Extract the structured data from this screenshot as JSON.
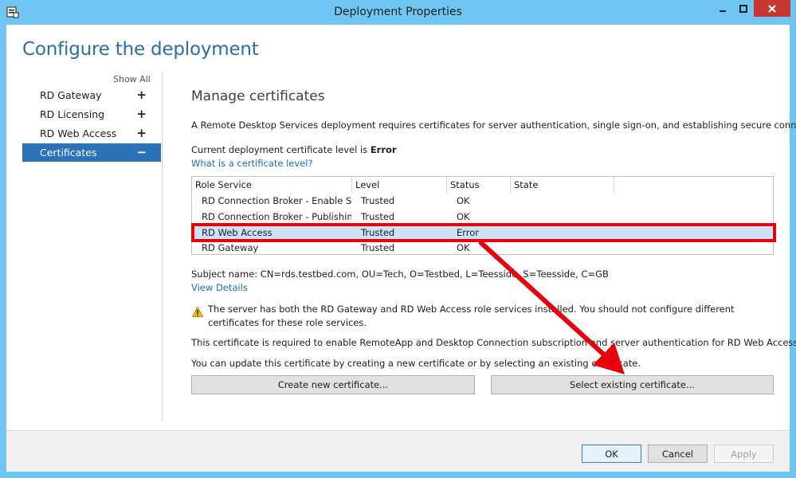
{
  "window": {
    "title": "Deployment Properties"
  },
  "page": {
    "heading": "Configure the deployment",
    "show_all": "Show All"
  },
  "sidebar": {
    "items": [
      {
        "label": "RD Gateway",
        "toggle": "+"
      },
      {
        "label": "RD Licensing",
        "toggle": "+"
      },
      {
        "label": "RD Web Access",
        "toggle": "+"
      },
      {
        "label": "Certificates",
        "toggle": "−"
      }
    ]
  },
  "main": {
    "title": "Manage certificates",
    "intro": "A Remote Desktop Services deployment requires certificates for server authentication, single sign-on, and establishing secure connections.",
    "level_prefix": "Current deployment certificate level is ",
    "level_value": "Error",
    "level_link": "What is a certificate level?",
    "table": {
      "headers": [
        "Role Service",
        "Level",
        "Status",
        "State"
      ],
      "rows": [
        {
          "role": "RD Connection Broker - Enable Single Sign On",
          "level": "Trusted",
          "status": "OK",
          "state": ""
        },
        {
          "role": "RD Connection Broker - Publishing",
          "level": "Trusted",
          "status": "OK",
          "state": ""
        },
        {
          "role": "RD Web Access",
          "level": "Trusted",
          "status": "Error",
          "state": ""
        },
        {
          "role": "RD Gateway",
          "level": "Trusted",
          "status": "OK",
          "state": ""
        }
      ]
    },
    "subject": "Subject name: CN=rds.testbed.com, OU=Tech, O=Testbed, L=Teesside, S=Teesside, C=GB",
    "view_details": "View Details",
    "warning": "The server has both the RD Gateway and RD Web Access role services installed. You should not configure different certificates for these role services.",
    "required": "This certificate is required to enable RemoteApp and Desktop Connection subscription and server authentication for RD Web Access.",
    "update": "You can update this certificate by creating a new certificate or by selecting an existing certificate.",
    "create_button": "Create new certificate...",
    "select_button": "Select existing certificate..."
  },
  "footer": {
    "ok": "OK",
    "cancel": "Cancel",
    "apply": "Apply"
  },
  "colors": {
    "titlebar": "#6fc6f3",
    "heading": "#2b6ea5",
    "selected_nav": "#2b72b8",
    "annotation": "#e8000b",
    "close": "#c7372f"
  }
}
